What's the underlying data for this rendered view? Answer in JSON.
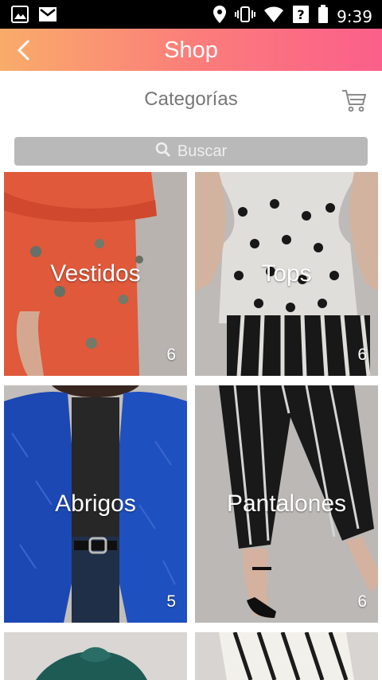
{
  "status_bar": {
    "time": "9:39",
    "icons": [
      "image-icon",
      "gmail-icon",
      "location-icon",
      "vibrate-icon",
      "wifi-icon",
      "signal-icon",
      "battery-icon"
    ]
  },
  "header": {
    "title": "Shop",
    "back_icon": "chevron-left-icon",
    "gradient": [
      "#f9ac6a",
      "#fb5f8a"
    ]
  },
  "subheader": {
    "title": "Categorías",
    "cart_icon": "cart-icon"
  },
  "search": {
    "placeholder": "Buscar",
    "icon": "search-icon"
  },
  "categories": [
    {
      "label": "Vestidos",
      "count": "6"
    },
    {
      "label": "Tops",
      "count": "6"
    },
    {
      "label": "Abrigos",
      "count": "5"
    },
    {
      "label": "Pantalones",
      "count": "6"
    },
    {
      "label": "",
      "count": ""
    },
    {
      "label": "",
      "count": ""
    }
  ]
}
